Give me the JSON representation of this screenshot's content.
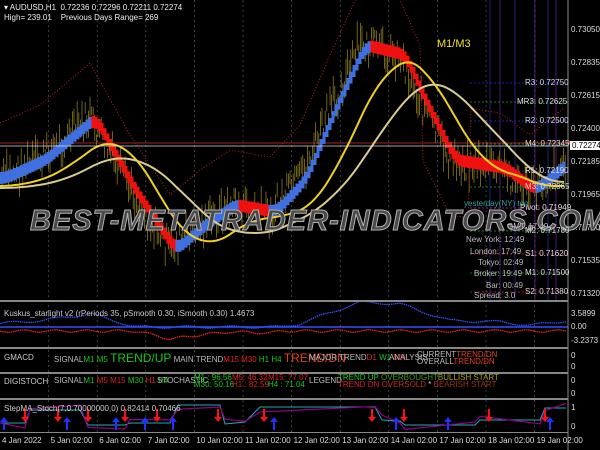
{
  "header": {
    "symbol": "AUDUSD,H1",
    "ohlc": "0.72236 0.72296 0.72211 0.72274",
    "high": "High= 239.01",
    "range": "Previous Days Range= 269"
  },
  "price_axis": [
    "0.73050",
    "0.72835",
    "0.72615",
    "0.72400",
    "0.72185",
    "0.71965",
    "0.71750",
    "0.71535",
    "0.71320"
  ],
  "current_price": "0.72274",
  "label_m1m3": "M1/M3",
  "watermark": "BEST-METATRADER-INDICATORS.COM",
  "pivots": [
    {
      "label": "R3: 0.72750",
      "color": "#2030ff"
    },
    {
      "label": "MR3: 0.72625",
      "color": "#20a020"
    },
    {
      "label": "R2: 0.72500",
      "color": "#2030ff"
    },
    {
      "label": "M4: 0.72345",
      "color": "#20a020"
    },
    {
      "label": "R1: 0.72190",
      "color": "#2030ff"
    },
    {
      "label": "M3: 0.72065",
      "color": "#20a020"
    },
    {
      "label": "Pivot: 0.71949",
      "color": "#d020d0"
    },
    {
      "label": "M2: 0.71780",
      "color": "#20a020"
    },
    {
      "label": "S1: 0.71620",
      "color": "#d02020"
    },
    {
      "label": "M1: 0.71500",
      "color": "#20a020"
    },
    {
      "label": "S2: 0.71380",
      "color": "#d02020"
    }
  ],
  "yesterday_label": "yesterday(NY) too",
  "sessions": [
    {
      "label": "GMT: 17:49"
    },
    {
      "label": "New York: 12:49"
    },
    {
      "label": "London: 17:49"
    },
    {
      "label": "Tokyo: 02:49"
    },
    {
      "label": "Broker: 19:49"
    },
    {
      "label": "Bar: 00:49"
    },
    {
      "label": "Spread: 3.0"
    }
  ],
  "kuskus": {
    "title": "Kuskus_starlight v2 (rPeriods 35, pSmooth 0.30, iSmooth 0.30)",
    "value": "1.4673",
    "axis": [
      "3.5899",
      "0.00",
      "-3.2373"
    ]
  },
  "gmacd": {
    "title": "GMACD",
    "signal": "SIGNAL",
    "tf1": "M1",
    "tf2": "M5",
    "trend1": "TREND/UP",
    "main_trend": "MAIN TREND",
    "tf3": "M15",
    "tf4": "M30",
    "tf5": "H1",
    "tf6": "H4",
    "trend2": "TREND/DN",
    "major_trend": "MAJOR TREND",
    "tf7": "D1",
    "tf8": "W1",
    "tf9": "MN",
    "analysis": "ANALYSIS",
    "current": "CURRENT",
    "overall": "OVERALL",
    "current_val": "TREND/DN",
    "overall_val": "TREND/DN",
    "axis": [
      "0",
      "0"
    ]
  },
  "digistoch": {
    "title": "DIGISTOCH",
    "signal": "SIGNAL",
    "tfs": [
      "M1",
      "M5",
      "M15",
      "M30",
      "H1",
      "H4"
    ],
    "stochastic": "STOCHASTIC",
    "m1": "M1 : 96.56",
    "m30": "M30: 50.16",
    "m5": "M5: 46.32",
    "h1": "H1 : 82.59",
    "m15": "M15: 77.07",
    "h4": "H4 : 71.04",
    "legend": "LEGEND",
    "trend_up": "TREND UP",
    "trend_dn": "TREND DN",
    "overbought": "OVERBOUGHT",
    "oversold": "OVERSOLD",
    "bullish": "BULLISH START",
    "bearish": "BEARISH START",
    "axis": [
      "0",
      "0"
    ]
  },
  "stepma": {
    "title": "StepMA_Stoch(7,0.70000000,0) 0.82414 0.70466",
    "axis": [
      "1",
      "0"
    ]
  },
  "time_axis": [
    "4 Jan 2022",
    "5 Jan 02:00",
    "6 Jan 02:00",
    "7 Jan 02:00",
    "10 Jan 02:00",
    "11 Jan 02:00",
    "12 Jan 02:00",
    "13 Jan 02:00",
    "14 Jan 02:00",
    "17 Jan 02:00",
    "18 Jan 02:00",
    "19 Jan 02:00"
  ]
}
